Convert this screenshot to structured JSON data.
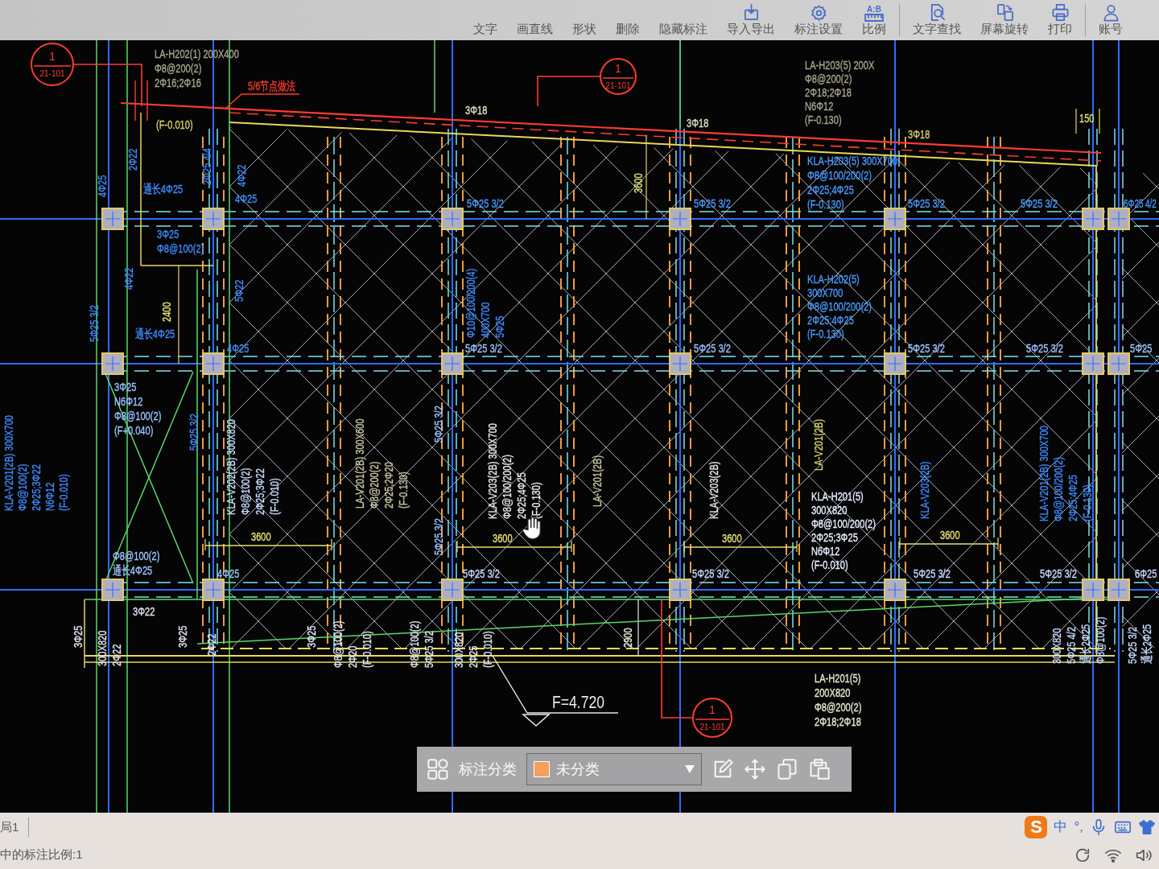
{
  "toolbar": {
    "items": [
      {
        "label": "文字",
        "kind": "text"
      },
      {
        "label": "画直线",
        "kind": "line"
      },
      {
        "label": "形状",
        "kind": "shape"
      },
      {
        "label": "删除",
        "kind": "delete"
      },
      {
        "label": "隐藏标注",
        "kind": "hide"
      },
      {
        "label": "导入导出",
        "kind": "import"
      },
      {
        "label": "标注设置",
        "kind": "settings"
      },
      {
        "label": "比例",
        "kind": "scale",
        "icon_text": "A:B"
      },
      {
        "label": "文字查找",
        "kind": "search",
        "group_start": true
      },
      {
        "label": "屏幕旋转",
        "kind": "rotate"
      },
      {
        "label": "打印",
        "kind": "print"
      },
      {
        "label": "账号",
        "kind": "account",
        "group_start": true
      }
    ]
  },
  "canvas": {
    "bubbles": [
      {
        "number": "1",
        "sheet": "21-101"
      },
      {
        "number": "1",
        "sheet": "21-101"
      },
      {
        "number": "1",
        "sheet": "21-101"
      }
    ],
    "notes": [
      {
        "kind": "note",
        "color": "#ff3b2f",
        "lines": [
          "5/6节点做法"
        ]
      },
      {
        "kind": "level",
        "color": "#d8cf68",
        "lines": [
          "(F-0.010)"
        ]
      }
    ],
    "beam_labels": [
      {
        "color": "#a9a68e",
        "lines": [
          "LA-H202(1) 200X400",
          "Φ8@200(2)",
          "2Φ16;2Φ16"
        ]
      },
      {
        "color": "#a9a68e",
        "lines": [
          "LA-H203(5) 200X",
          "Φ8@200(2)",
          "2Φ18;2Φ18",
          "N6Φ12",
          "(F-0.130)"
        ]
      },
      {
        "color": "#4a9cff",
        "lines": [
          "KLA-H203(5) 300X700",
          "Φ8@100/200(2)",
          "2Φ25;4Φ25",
          "(F-0.130)"
        ]
      },
      {
        "color": "#3f8cff",
        "lines": [
          "Φ10@100/200(4)",
          "400X700",
          "5Φ25"
        ]
      },
      {
        "color": "#4a9cff",
        "lines": [
          "KLA-H202(5)",
          "300X700",
          "Φ8@100/200(2)",
          "2Φ25;4Φ25",
          "(F-0.130)"
        ]
      },
      {
        "color": "#3f8cff",
        "lines": [
          "KLA-V201(2B) 300X700",
          "Φ8@100(2)",
          "2Φ25;3Φ22",
          "N6Φ12",
          "(F-0.010)"
        ]
      },
      {
        "color": "#9cc4ff",
        "lines": [
          "3Φ25",
          "N6Φ12",
          "Φ8@100(2)",
          "(F+0.040)"
        ]
      },
      {
        "color": "#c8dcff",
        "lines": [
          "KLA-V202(2B) 300X820",
          "Φ8@100(2)",
          "2Φ25;3Φ22",
          "(F-0.010)"
        ]
      },
      {
        "color": "#c8c4a0",
        "lines": [
          "LA-V201(2B) 300X600",
          "Φ8@200(2)",
          "2Φ25;2Φ20",
          "(F-0.130)"
        ]
      },
      {
        "color": "#e8e8e8",
        "lines": [
          "KLA-V203(2B) 300X700",
          "Φ8@100/200(2)",
          "2Φ25;4Φ25",
          "(F-0.130)"
        ]
      },
      {
        "color": "#c8c4a0",
        "lines": [
          "LA-V201(2B)"
        ]
      },
      {
        "color": "#e8e8e8",
        "lines": [
          "KLA-V203(2B)"
        ]
      },
      {
        "color": "#d8cf68",
        "lines": [
          "LA-V201(2B)"
        ]
      },
      {
        "color": "#e8f0ff",
        "lines": [
          "KLA-H201(5)",
          "300X820",
          "Φ8@100/200(2)",
          "2Φ25;3Φ25",
          "N6Φ12",
          "(F-0.010)"
        ]
      },
      {
        "color": "#3f8cff",
        "lines": [
          "KLA-V203(2B)"
        ]
      },
      {
        "color": "#3f8cff",
        "lines": [
          "KLA-V201(2B) 300X700",
          "Φ8@100/200(2)",
          "2Φ25;4Φ25",
          "(F-0.130)"
        ]
      },
      {
        "color": "#e0e6f0",
        "lines": [
          "300X820",
          "2Φ22"
        ]
      },
      {
        "color": "#e0e6f0",
        "lines": [
          "Φ8@100(2)",
          "2Φ20",
          "(F-0.010)"
        ]
      },
      {
        "color": "#e0e6f0",
        "lines": [
          "Φ8@100(2)",
          "5Φ25 3/2"
        ]
      },
      {
        "color": "#e0e6f0",
        "lines": [
          "300X820",
          "2Φ25",
          "(F-0.010)"
        ]
      },
      {
        "color": "#c8dcff",
        "lines": [
          "300X820",
          "5Φ25 4/2",
          "通长2Φ25",
          "Φ8@100(2)"
        ]
      },
      {
        "color": "#e8e8d0",
        "lines": [
          "LA-H201(5)",
          "200X820",
          "Φ8@200(2)",
          "2Φ18;2Φ18"
        ]
      }
    ],
    "rebar_labels": [
      {
        "color": "#e2dfc0",
        "lines": [
          "3Φ18"
        ]
      },
      {
        "color": "#e2dfc0",
        "lines": [
          "3Φ18"
        ]
      },
      {
        "color": "#d8cf68",
        "lines": [
          "3Φ18"
        ]
      },
      {
        "color": "#3f8cff",
        "lines": [
          "2Φ22"
        ]
      },
      {
        "color": "#3f8cff",
        "lines": [
          "4Φ25"
        ]
      },
      {
        "color": "#3f8cff",
        "lines": [
          "通长4Φ25"
        ]
      },
      {
        "color": "#3f8cff",
        "lines": [
          "2Φ25 4/4"
        ]
      },
      {
        "color": "#3f8cff",
        "lines": [
          "4Φ22"
        ]
      },
      {
        "color": "#3f8cff",
        "lines": [
          "4Φ25"
        ]
      },
      {
        "color": "#4a9cff",
        "lines": [
          "5Φ25 3/2"
        ]
      },
      {
        "color": "#4a9cff",
        "lines": [
          "5Φ25 3/2"
        ]
      },
      {
        "color": "#4a9cff",
        "lines": [
          "5Φ25 3/2"
        ]
      },
      {
        "color": "#4a9cff",
        "lines": [
          "5Φ25 3/2"
        ]
      },
      {
        "color": "#4a9cff",
        "lines": [
          "6Φ25 4/2"
        ]
      },
      {
        "color": "#3f8cff",
        "lines": [
          "3Φ25",
          "Φ8@100(2)"
        ]
      },
      {
        "color": "#3f8cff",
        "lines": [
          "4Φ22"
        ]
      },
      {
        "color": "#3f8cff",
        "lines": [
          "5Φ22"
        ]
      },
      {
        "color": "#3f8cff",
        "lines": [
          "5Φ25 3/2"
        ]
      },
      {
        "color": "#3f8cff",
        "lines": [
          "通长4Φ25"
        ]
      },
      {
        "color": "#3f8cff",
        "lines": [
          "4Φ25"
        ]
      },
      {
        "color": "#9cc4ff",
        "lines": [
          "5Φ25 3/2"
        ]
      },
      {
        "color": "#9cc4ff",
        "lines": [
          "5Φ25 3/2"
        ]
      },
      {
        "color": "#9cc4ff",
        "lines": [
          "5Φ25 3/2"
        ]
      },
      {
        "color": "#9cc4ff",
        "lines": [
          "5Φ25 3/2"
        ]
      },
      {
        "color": "#9cc4ff",
        "lines": [
          "5Φ25"
        ]
      },
      {
        "color": "#3f8cff",
        "lines": [
          "5Φ25 3/2"
        ]
      },
      {
        "color": "#9cc4ff",
        "lines": [
          "5Φ25 3/2"
        ]
      },
      {
        "color": "#9cc4ff",
        "lines": [
          "Φ8@100(2)",
          "通长4Φ25"
        ]
      },
      {
        "color": "#9cc4ff",
        "lines": [
          "5Φ25 3/2"
        ]
      },
      {
        "color": "#9cc4ff",
        "lines": [
          "4Φ25"
        ]
      },
      {
        "color": "#c8dcff",
        "lines": [
          "5Φ25 3/2"
        ]
      },
      {
        "color": "#c8dcff",
        "lines": [
          "5Φ25 3/2"
        ]
      },
      {
        "color": "#c8dcff",
        "lines": [
          "5Φ25 3/2"
        ]
      },
      {
        "color": "#c8dcff",
        "lines": [
          "5Φ25 3/2"
        ]
      },
      {
        "color": "#c8dcff",
        "lines": [
          "6Φ25"
        ]
      },
      {
        "color": "#e0e6f0",
        "lines": [
          "3Φ22"
        ]
      },
      {
        "color": "#e0e6f0",
        "lines": [
          "3Φ25"
        ]
      },
      {
        "color": "#e0e6f0",
        "lines": [
          "3Φ25"
        ]
      },
      {
        "color": "#e0e6f0",
        "lines": [
          "2Φ22"
        ]
      },
      {
        "color": "#e0e6f0",
        "lines": [
          "3Φ25"
        ]
      },
      {
        "color": "#c8dcff",
        "lines": [
          "5Φ25 3/2",
          "通长2Φ25"
        ]
      }
    ],
    "dimension_labels": [
      {
        "color": "#d8e070",
        "lines": [
          "150"
        ]
      },
      {
        "color": "#d8e070",
        "lines": [
          "3600"
        ]
      },
      {
        "color": "#e6e070",
        "lines": [
          "2400"
        ]
      },
      {
        "color": "#e6e070",
        "lines": [
          "3600"
        ]
      },
      {
        "color": "#e6e070",
        "lines": [
          "3600"
        ]
      },
      {
        "color": "#e6e070",
        "lines": [
          "3600"
        ]
      },
      {
        "color": "#e6e070",
        "lines": [
          "3600"
        ]
      },
      {
        "color": "#e8e8d0",
        "lines": [
          "2900"
        ]
      }
    ],
    "elevation": {
      "text": "F=4.720"
    }
  },
  "classifier_bar": {
    "label": "标注分类",
    "value": "未分类",
    "color": "#f4a05a"
  },
  "status_bar": {
    "layout_tab": "局1",
    "message": "中的标注比例:1",
    "ime": {
      "logo": "S",
      "mode": "中",
      "punctuation": "°,"
    }
  }
}
